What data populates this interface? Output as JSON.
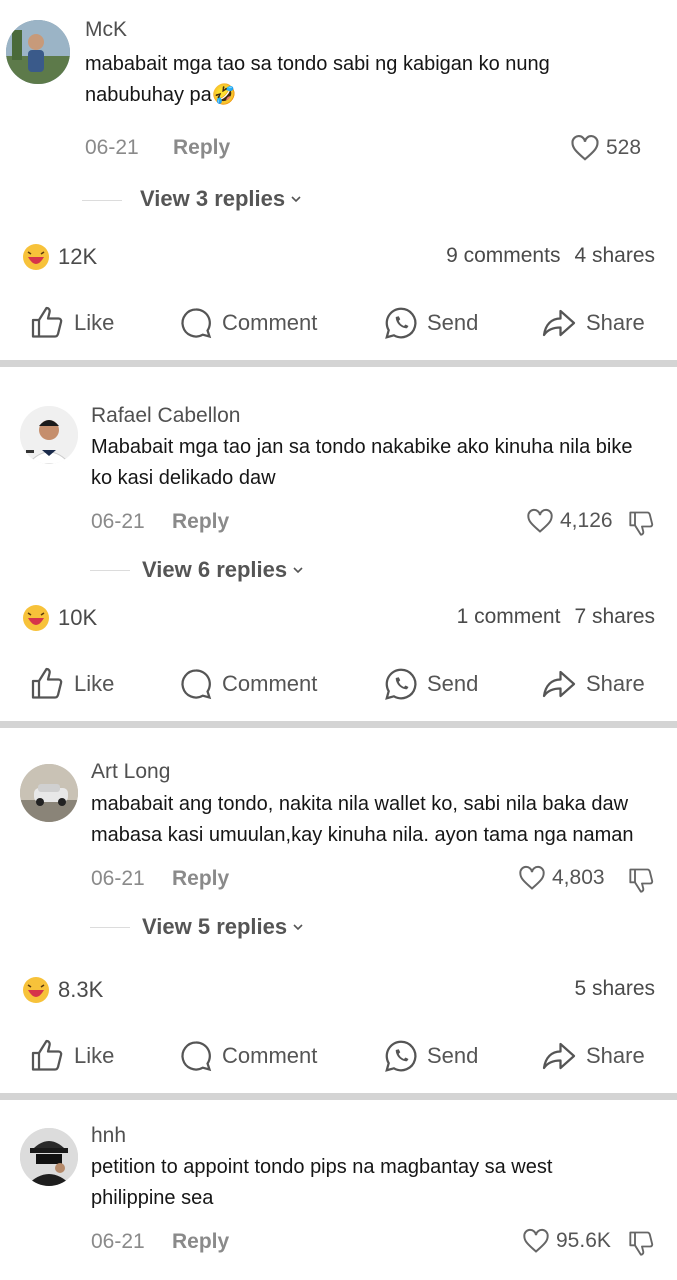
{
  "comments": [
    {
      "author": "McK",
      "text_lines": [
        "mababait mga tao sa tondo sabi ng kabigan ko nung",
        "nabubuhay pa🤣"
      ],
      "date": "06-21",
      "reply": "Reply",
      "likes": "528",
      "view_replies": "View 3 replies"
    },
    {
      "author": "Rafael Cabellon",
      "text_lines": [
        "Mababait mga tao jan sa tondo nakabike ako kinuha nila bike",
        "ko kasi delikado daw"
      ],
      "date": "06-21",
      "reply": "Reply",
      "likes": "4,126",
      "view_replies": "View 6 replies"
    },
    {
      "author": "Art Long",
      "text_lines": [
        "mababait ang tondo, nakita nila wallet ko, sabi nila baka daw",
        "mabasa kasi umuulan,kay kinuha nila. ayon tama nga naman"
      ],
      "date": "06-21",
      "reply": "Reply",
      "likes": "4,803",
      "view_replies": "View 5 replies"
    },
    {
      "author": "hnh",
      "text_lines": [
        "petition to appoint tondo pips na magbantay sa west",
        "philippine sea"
      ],
      "date": "06-21",
      "reply": "Reply",
      "likes": "95.6K"
    }
  ],
  "posts": [
    {
      "reaction_count": "12K",
      "comments": "9 comments",
      "shares": "4 shares"
    },
    {
      "reaction_count": "10K",
      "comments": "1 comment",
      "shares": "7 shares"
    },
    {
      "reaction_count": "8.3K",
      "comments": "",
      "shares": "5 shares"
    }
  ],
  "actions": {
    "like": "Like",
    "comment": "Comment",
    "send": "Send",
    "share": "Share"
  },
  "colors": {
    "divider": "#d4d4d4",
    "muted": "#8a8a8a",
    "haha_yellow": "#f7c23a",
    "haha_mouth": "#d6344a"
  },
  "icons": [
    "heart-icon",
    "dislike-icon",
    "chevron-down-icon",
    "haha-emoji-icon",
    "thumbs-up-icon",
    "comment-bubble-icon",
    "whatsapp-icon",
    "share-arrow-icon"
  ]
}
